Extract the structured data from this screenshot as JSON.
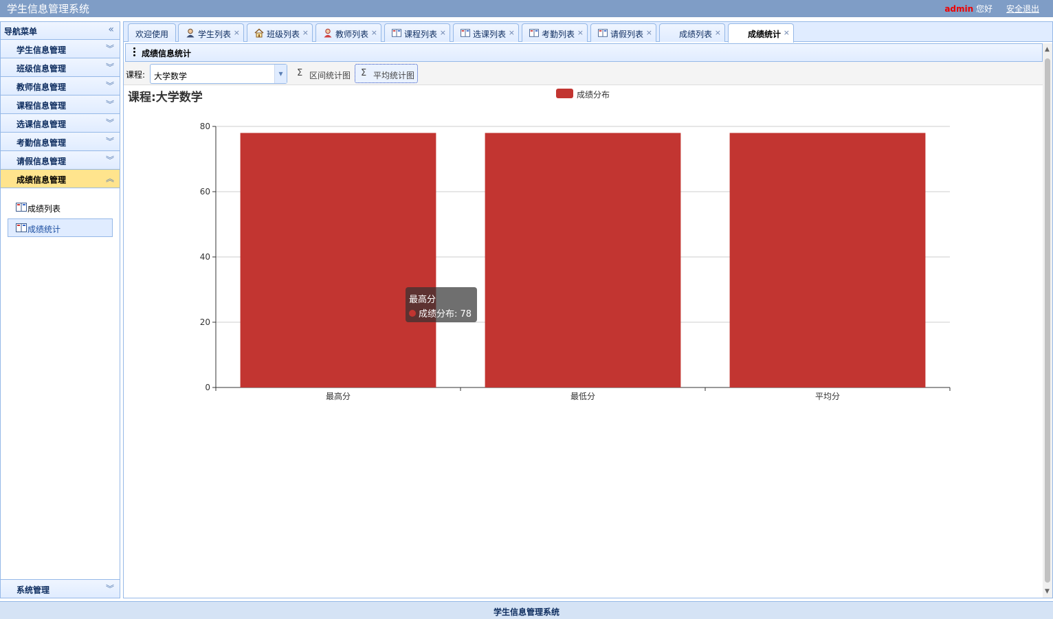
{
  "header": {
    "app_title": "学生信息管理系统",
    "username": "admin",
    "greeting": " 您好",
    "logout": "安全退出"
  },
  "sidebar": {
    "title": "导航菜单",
    "groups": [
      {
        "label": "学生信息管理"
      },
      {
        "label": "班级信息管理"
      },
      {
        "label": "教师信息管理"
      },
      {
        "label": "课程信息管理"
      },
      {
        "label": "选课信息管理"
      },
      {
        "label": "考勤信息管理"
      },
      {
        "label": "请假信息管理"
      },
      {
        "label": "成绩信息管理"
      }
    ],
    "sub_items": [
      {
        "label": "成绩列表"
      },
      {
        "label": "成绩统计"
      }
    ],
    "bottom": {
      "label": "系统管理"
    }
  },
  "tabs": [
    {
      "label": "欢迎使用"
    },
    {
      "label": "学生列表"
    },
    {
      "label": "班级列表"
    },
    {
      "label": "教师列表"
    },
    {
      "label": "课程列表"
    },
    {
      "label": "选课列表"
    },
    {
      "label": "考勤列表"
    },
    {
      "label": "请假列表"
    },
    {
      "label": "成绩列表"
    },
    {
      "label": "成绩统计"
    }
  ],
  "panel": {
    "title": "成绩信息统计"
  },
  "toolbar": {
    "course_label": "课程:",
    "course_value": "大学数学",
    "btn_range": "区间统计图",
    "btn_avg": "平均统计图",
    "sigma": "Σ"
  },
  "chart_title": "课程:大学数学",
  "tooltip": {
    "title": "最高分",
    "text": "成绩分布: 78"
  },
  "colors": {
    "series": "#c23531",
    "header": "#7f9dc6",
    "accent_active": "#ffe48d"
  },
  "chart_data": {
    "type": "bar",
    "categories": [
      "最高分",
      "最低分",
      "平均分"
    ],
    "series": [
      {
        "name": "成绩分布",
        "values": [
          78,
          78,
          78
        ]
      }
    ],
    "ylim": [
      0,
      80
    ],
    "yticks": [
      0,
      20,
      40,
      60,
      80
    ],
    "legend": "top-center",
    "grid": true
  },
  "footer": {
    "text": "学生信息管理系统"
  }
}
